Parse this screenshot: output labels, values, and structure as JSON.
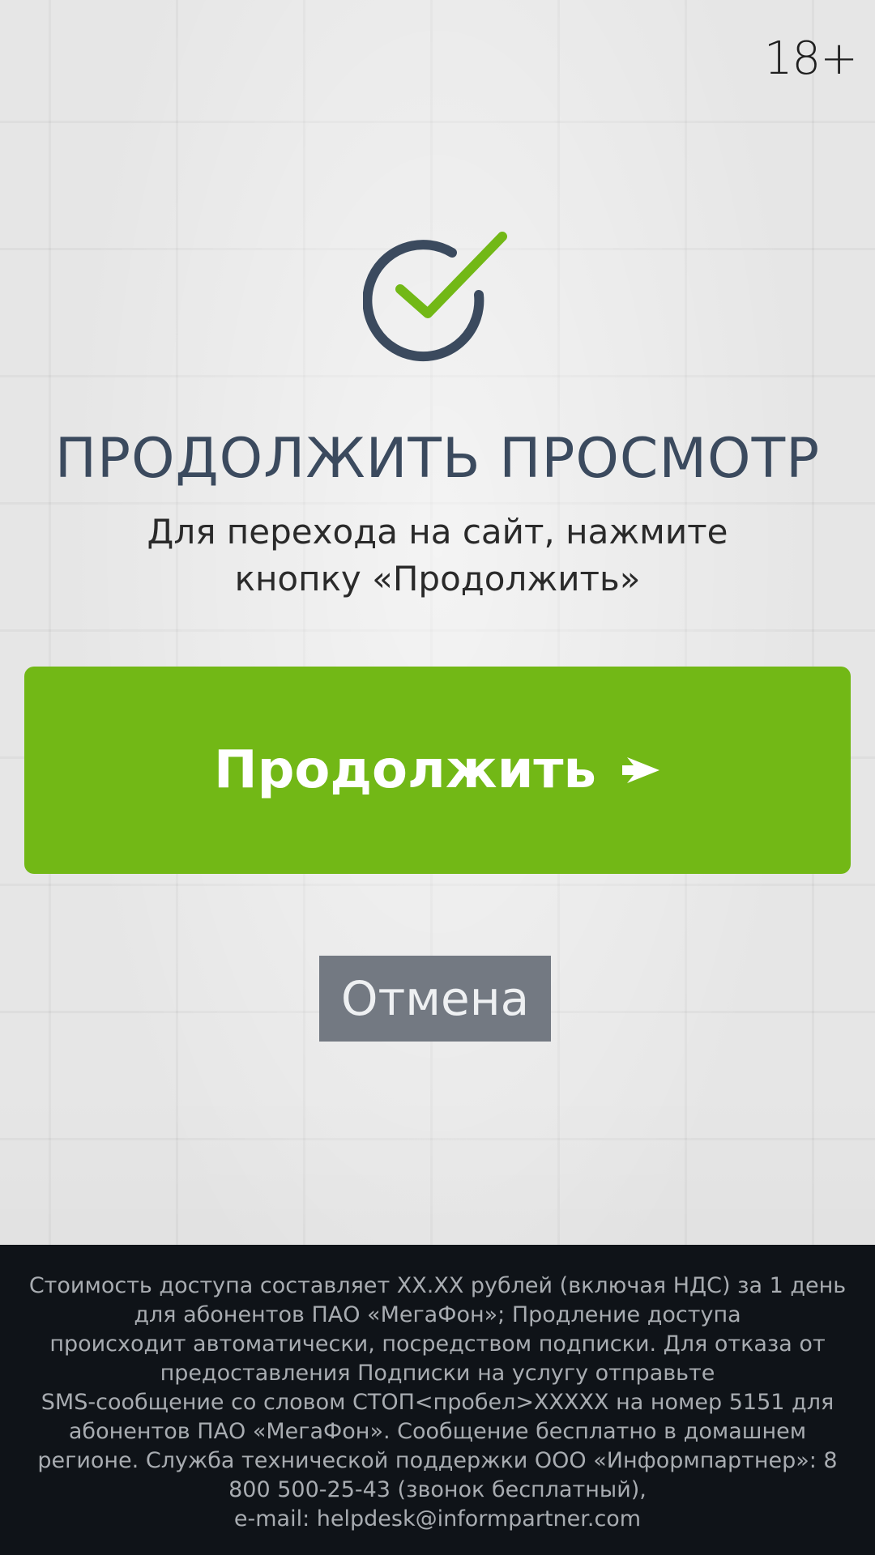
{
  "age_rating": "18+",
  "header": {
    "icon": "check-circle-icon",
    "title": "ПРОДОЛЖИТЬ ПРОСМОТР",
    "subtitle_line1": "Для перехода на сайт, нажмите",
    "subtitle_line2": "кнопку «Продолжить»"
  },
  "actions": {
    "continue_label": "Продолжить",
    "continue_icon": "arrow-right-icon",
    "cancel_label": "Отмена"
  },
  "footer": {
    "lines": [
      "Стоимость доступа составляет XX.XX рублей (включая НДС) за 1 день",
      "для абонентов ПАО «МегаФон»; Продление доступа",
      "происходит автоматически, посредством подписки. Для отказа от",
      "предоставления Подписки на услугу отправьте",
      "SMS-сообщение со словом СТОП<пробел>XXXXX на номер 5151 для",
      "абонентов ПАО «МегаФон». Сообщение бесплатно в домашнем",
      "регионе. Служба технической поддержки ООО «Информпартнер»: 8",
      "800 500-25-43 (звонок бесплатный),",
      "e-mail: helpdesk@informpartner.com"
    ]
  },
  "colors": {
    "accent_green": "#72b816",
    "title_slate": "#3b4a5e",
    "cancel_gray": "#737982",
    "footer_bg": "#0f1318",
    "footer_text": "#a8acb1"
  }
}
